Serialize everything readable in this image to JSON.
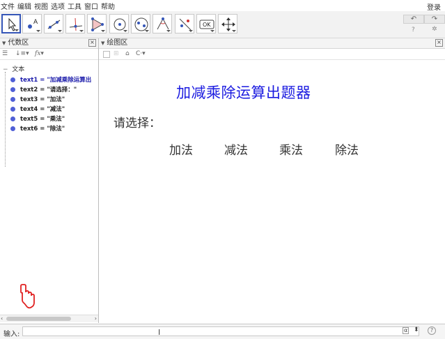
{
  "menu": [
    "文件",
    "编辑",
    "视图",
    "选项",
    "工具",
    "窗口",
    "帮助"
  ],
  "login": "登录",
  "toolbar": {
    "tools": [
      "move-tool",
      "point-tool",
      "line-tool",
      "perpendicular-tool",
      "polygon-tool",
      "circle-tool",
      "ellipse-tool",
      "angle-tool",
      "reflect-tool",
      "button-tool",
      "move-view-tool"
    ],
    "ok_label": "OK",
    "undo": "↶",
    "redo": "↷"
  },
  "algebra": {
    "title": "代数区",
    "group": "文本",
    "items": [
      {
        "label": "text1 = \"加减乘除运算出"
      },
      {
        "label": "text2 = \"请选择：\""
      },
      {
        "label": "text3 = \"加法\""
      },
      {
        "label": "text4 = \"减法\""
      },
      {
        "label": "text5 = \"乘法\""
      },
      {
        "label": "text6 = \"除法\""
      }
    ]
  },
  "graphics": {
    "title": "绘图区",
    "heading": "加减乘除运算出题器",
    "prompt": "请选择：",
    "options": [
      "加法",
      "减法",
      "乘法",
      "除法"
    ],
    "heading_color": "#1a1ae0"
  },
  "input": {
    "label": "输入:",
    "value": ""
  },
  "colors": {
    "accent": "#3556b8",
    "dot": "#4f5fd6",
    "hand": "#e02020"
  }
}
